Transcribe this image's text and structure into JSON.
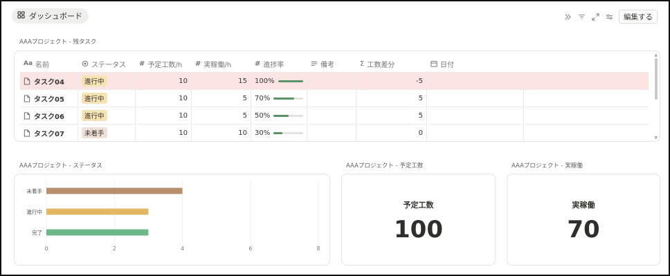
{
  "header": {
    "dashboard_label": "ダッシュボード",
    "edit_label": "編集する"
  },
  "table_section": {
    "title": "AAAプロジェクト - 残タスク",
    "columns": [
      "名前",
      "ステータス",
      "予定工数/h",
      "実稼働/h",
      "進捗率",
      "備考",
      "工数差分",
      "日付"
    ],
    "rows": [
      {
        "name": "タスク04",
        "status": "進行中",
        "status_color": "#f6e3b4",
        "plan": "10",
        "actual": "15",
        "progress": "100%",
        "progress_value": 1.0,
        "note": "",
        "diff": "-5",
        "date": "",
        "highlight": true
      },
      {
        "name": "タスク05",
        "status": "進行中",
        "status_color": "#f6e3b4",
        "plan": "10",
        "actual": "5",
        "progress": "70%",
        "progress_value": 0.7,
        "note": "",
        "diff": "5",
        "date": "",
        "highlight": false
      },
      {
        "name": "タスク06",
        "status": "進行中",
        "status_color": "#f6e3b4",
        "plan": "10",
        "actual": "5",
        "progress": "50%",
        "progress_value": 0.5,
        "note": "",
        "diff": "5",
        "date": "",
        "highlight": false
      },
      {
        "name": "タスク07",
        "status": "未着手",
        "status_color": "#f0e2da",
        "plan": "10",
        "actual": "10",
        "progress": "30%",
        "progress_value": 0.3,
        "note": "",
        "diff": "0",
        "date": "",
        "highlight": false
      }
    ]
  },
  "status_section": {
    "title": "AAAプロジェクト - ステータス"
  },
  "chart_data": {
    "type": "bar",
    "orientation": "horizontal",
    "categories": [
      "未着手",
      "進行中",
      "完了"
    ],
    "values": [
      4,
      3,
      3
    ],
    "colors": [
      "#b9906e",
      "#e3b865",
      "#6cb888"
    ],
    "xlim": [
      0,
      8
    ],
    "xticks": [
      "0",
      "2",
      "4",
      "6",
      "8"
    ],
    "grid": true
  },
  "plan_section": {
    "title": "AAAプロジェクト - 予定工数",
    "label": "予定工数",
    "value": "100"
  },
  "actual_section": {
    "title": "AAAプロジェクト - 実稼働",
    "label": "実稼働",
    "value": "70"
  }
}
